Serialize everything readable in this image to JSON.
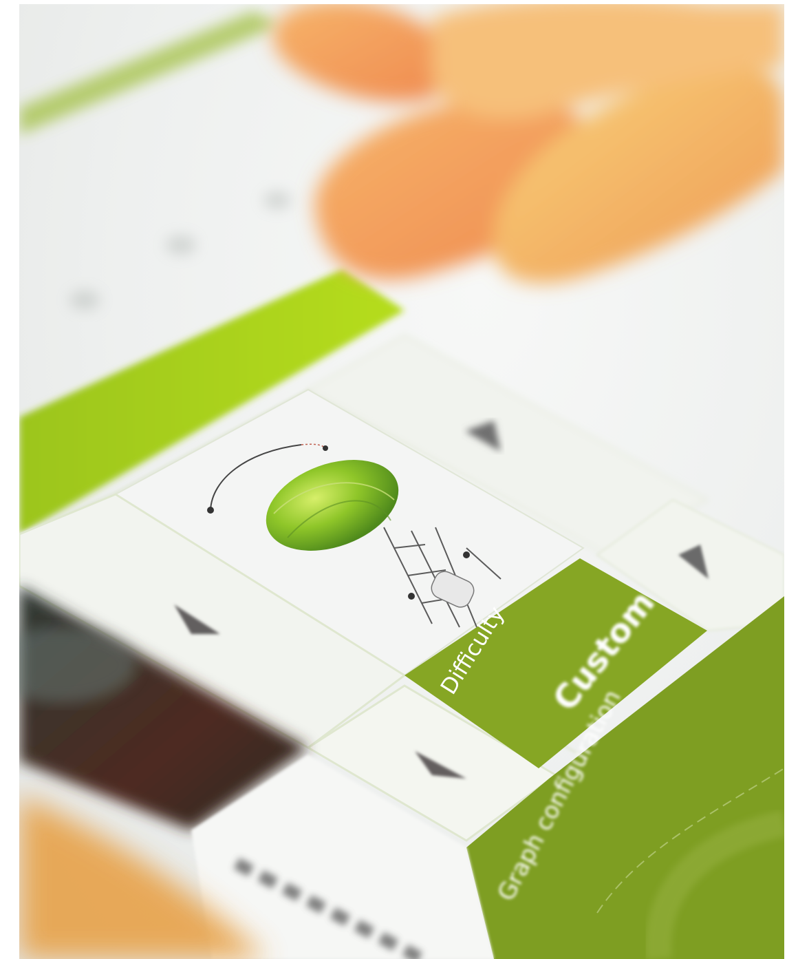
{
  "difficulty_tile": {
    "label": "Difficulty",
    "value": "Custom"
  },
  "graph_tile": {
    "label": "Graph configuration"
  },
  "bottom_label": {
    "text": "...",
    "note": ""
  },
  "icons": {
    "up_arrow_top": "triangle-up-icon",
    "up_arrow_right": "triangle-up-icon",
    "down_arrow_left": "triangle-down-icon",
    "down_arrow_mid": "triangle-down-icon",
    "illustration": "green-sphere-graph-icon"
  },
  "colors": {
    "accent_green": "#8aa623",
    "bright_green": "#a9d11a",
    "tile_bg": "#f3f5ef",
    "finger": "#f2a25f"
  }
}
